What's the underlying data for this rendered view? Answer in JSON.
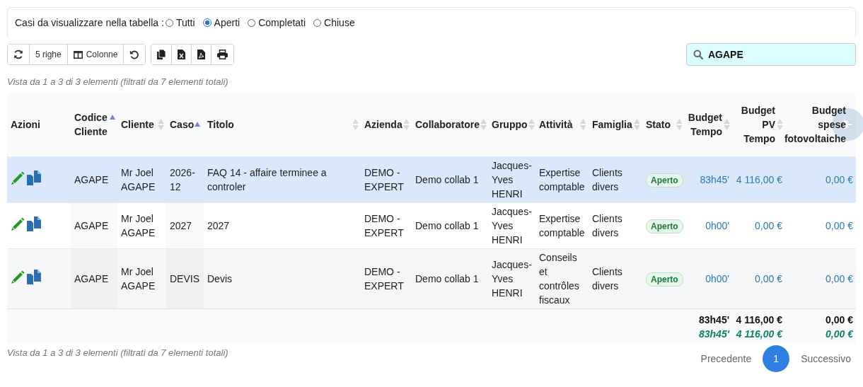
{
  "filter": {
    "label": "Casi da visualizzare nella tabella :",
    "options": [
      {
        "label": "Tutti",
        "selected": false
      },
      {
        "label": "Aperti",
        "selected": true
      },
      {
        "label": "Completati",
        "selected": false
      },
      {
        "label": "Chiuse",
        "selected": false
      }
    ]
  },
  "toolbar": [
    [
      {
        "kind": "refresh"
      },
      {
        "kind": "text",
        "label": "5 righe"
      },
      {
        "kind": "columns",
        "label": "Colonne"
      },
      {
        "kind": "undo"
      }
    ],
    [
      {
        "kind": "copy"
      },
      {
        "kind": "excel"
      },
      {
        "kind": "pdf"
      },
      {
        "kind": "print"
      }
    ]
  ],
  "search": {
    "value": "AGAPE"
  },
  "info_top": "Vista da 1 a 3 di 3 elementi (filtrati da 7 elementi totali)",
  "table": {
    "columns": [
      {
        "label": "Azioni",
        "kind": "actions"
      },
      {
        "label": "Codice Cliente",
        "kind": "text",
        "sorted": true
      },
      {
        "label": "Cliente",
        "kind": "text",
        "sorted": false
      },
      {
        "label": "Caso",
        "kind": "text",
        "sorted": true
      },
      {
        "label": "Titolo",
        "kind": "text",
        "sorted": false
      },
      {
        "label": "Azienda",
        "kind": "text",
        "sorted": false
      },
      {
        "label": "Collaboratore",
        "kind": "text",
        "sorted": false
      },
      {
        "label": "Gruppo",
        "kind": "text",
        "sorted": false
      },
      {
        "label": "Attività",
        "kind": "text",
        "sorted": false
      },
      {
        "label": "Famiglia",
        "kind": "text",
        "sorted": false
      },
      {
        "label": "Stato",
        "kind": "badge",
        "sorted": false
      },
      {
        "label": "Budget Tempo",
        "kind": "amount",
        "sorted": false
      },
      {
        "label": "Budget PV Tempo",
        "kind": "amount",
        "sorted": false
      },
      {
        "label": "Budget spese fotovoltaiche",
        "kind": "amount",
        "sorted": false
      }
    ],
    "rows": [
      {
        "selected": true,
        "cells": [
          "",
          "AGAPE",
          "Mr Joel AGAPE",
          "2026-12",
          "FAQ 14 - affaire terminee a controler",
          "DEMO - EXPERT",
          "Demo collab 1",
          "Jacques-Yves HENRI",
          "Expertise comptable",
          "Clients divers",
          "Aperto",
          "83h45'",
          "4 116,00 €",
          "0,00 €"
        ]
      },
      {
        "selected": false,
        "cells": [
          "",
          "AGAPE",
          "Mr Joel AGAPE",
          "2027",
          "2027",
          "DEMO - EXPERT",
          "Demo collab 1",
          "Jacques-Yves HENRI",
          "Expertise comptable",
          "Clients divers",
          "Aperto",
          "0h00'",
          "0,00 €",
          "0,00 €"
        ]
      },
      {
        "selected": false,
        "cells": [
          "",
          "AGAPE",
          "Mr Joel AGAPE",
          "DEVIS",
          "Devis",
          "DEMO - EXPERT",
          "Demo collab 1",
          "Jacques-Yves HENRI",
          "Conseils et contrôles fiscaux",
          "Clients divers",
          "Aperto",
          "0h00'",
          "0,00 €",
          "0,00 €"
        ]
      }
    ],
    "totals": [
      {
        "kind": "page",
        "values": [
          "83h45'",
          "4 116,00 €",
          "0,00 €"
        ]
      },
      {
        "kind": "overall",
        "values": [
          "83h45'",
          "4 116,00 €",
          "0,00 €"
        ]
      }
    ]
  },
  "info_bottom": "Vista da 1 a 3 di 3 elementi (filtrati da 7 elementi totali)",
  "pagination": {
    "previous": "Precedente",
    "pages": [
      {
        "label": "1",
        "selected": true
      }
    ],
    "next": "Successivo"
  }
}
